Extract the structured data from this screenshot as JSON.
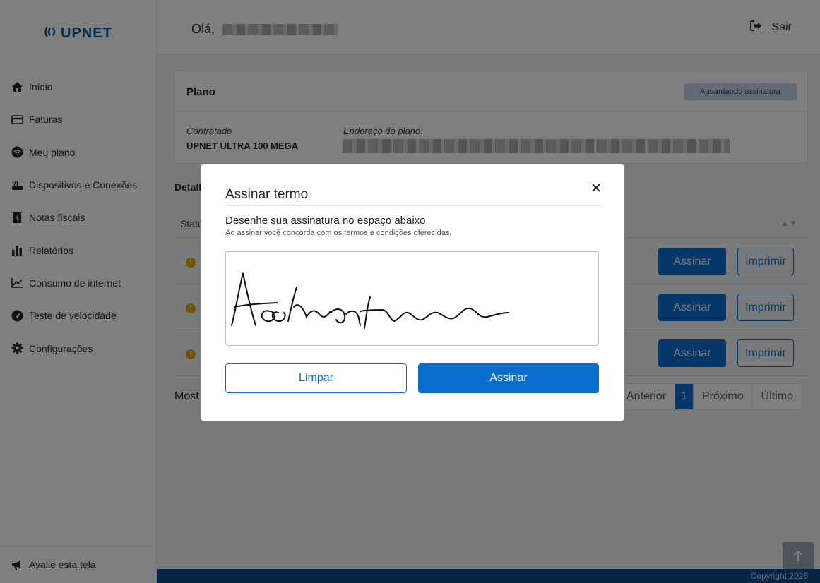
{
  "brand": {
    "logo_text": "UPNET",
    "color": "#0d5aa6"
  },
  "header": {
    "greeting": "Olá,",
    "logout_label": "Sair"
  },
  "sidebar": {
    "items": [
      {
        "label": "Início",
        "icon": "home-icon"
      },
      {
        "label": "Faturas",
        "icon": "credit-card-icon"
      },
      {
        "label": "Meu plano",
        "icon": "wifi-icon"
      },
      {
        "label": "Dispositivos e Conexões",
        "icon": "router-icon"
      },
      {
        "label": "Notas fiscais",
        "icon": "receipt-icon"
      },
      {
        "label": "Relatórios",
        "icon": "bar-chart-icon"
      },
      {
        "label": "Consumo de internet",
        "icon": "line-chart-icon"
      },
      {
        "label": "Teste de velocidade",
        "icon": "speedometer-icon"
      },
      {
        "label": "Configurações",
        "icon": "gear-icon"
      }
    ],
    "bottom_item": {
      "label": "Avalie esta tela",
      "icon": "megaphone-icon"
    }
  },
  "plan_card": {
    "title": "Plano",
    "status_badge": "Aguardando assinatura",
    "contract_label": "Contratado",
    "contract_value": "UPNET ULTRA 100 MEGA",
    "address_label": "Endereço do plano:"
  },
  "details": {
    "title_partial": "Detalh",
    "status_header_partial": "Statu",
    "rows": [
      {
        "sign_label": "Assinar",
        "print_label": "Imprimir"
      },
      {
        "sign_label": "Assinar",
        "print_label": "Imprimir"
      },
      {
        "sign_label": "Assinar",
        "print_label": "Imprimir"
      }
    ],
    "showing_partial": "Most"
  },
  "pagination": {
    "previous": "Anterior",
    "current": "1",
    "next": "Próximo",
    "last": "Último"
  },
  "footer": {
    "copyright": "Copyright 2026"
  },
  "modal": {
    "title": "Assinar termo",
    "instruction": "Desenhe sua assinatura no espaço abaixo",
    "subtext": "Ao assinar você concorda com os termos e condições oferecidas.",
    "clear_label": "Limpar",
    "submit_label": "Assinar"
  },
  "colors": {
    "primary": "#0a6ed1",
    "footer": "#0f4c8a",
    "warning": "#e0a800",
    "badge": "#c5d7ea"
  }
}
